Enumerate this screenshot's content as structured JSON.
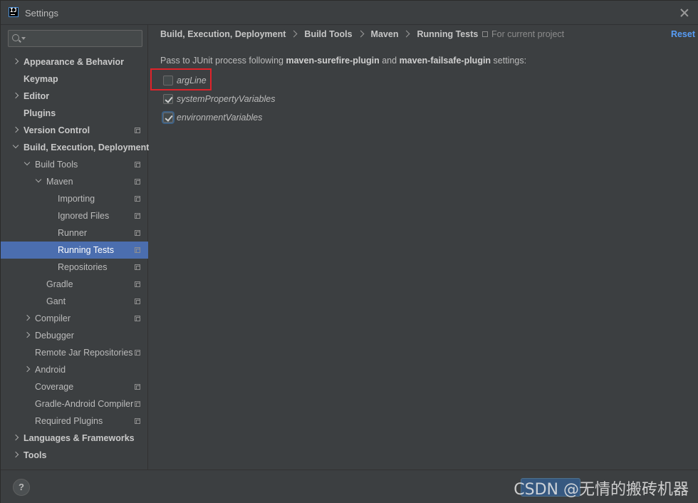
{
  "window": {
    "title": "Settings"
  },
  "sidebar": {
    "search": {
      "value": "",
      "placeholder": ""
    },
    "items": [
      {
        "label": "Appearance & Behavior",
        "level": 0,
        "arrow": "right",
        "bold": true,
        "project": false,
        "selected": false
      },
      {
        "label": "Keymap",
        "level": 0,
        "arrow": "none",
        "bold": true,
        "project": false,
        "selected": false
      },
      {
        "label": "Editor",
        "level": 0,
        "arrow": "right",
        "bold": true,
        "project": false,
        "selected": false
      },
      {
        "label": "Plugins",
        "level": 0,
        "arrow": "none",
        "bold": true,
        "project": false,
        "selected": false
      },
      {
        "label": "Version Control",
        "level": 0,
        "arrow": "right",
        "bold": true,
        "project": true,
        "selected": false
      },
      {
        "label": "Build, Execution, Deployment",
        "level": 0,
        "arrow": "down",
        "bold": true,
        "project": false,
        "selected": false
      },
      {
        "label": "Build Tools",
        "level": 1,
        "arrow": "down",
        "bold": false,
        "project": true,
        "selected": false
      },
      {
        "label": "Maven",
        "level": 2,
        "arrow": "down",
        "bold": false,
        "project": true,
        "selected": false
      },
      {
        "label": "Importing",
        "level": 3,
        "arrow": "none",
        "bold": false,
        "project": true,
        "selected": false
      },
      {
        "label": "Ignored Files",
        "level": 3,
        "arrow": "none",
        "bold": false,
        "project": true,
        "selected": false
      },
      {
        "label": "Runner",
        "level": 3,
        "arrow": "none",
        "bold": false,
        "project": true,
        "selected": false
      },
      {
        "label": "Running Tests",
        "level": 3,
        "arrow": "none",
        "bold": false,
        "project": true,
        "selected": true
      },
      {
        "label": "Repositories",
        "level": 3,
        "arrow": "none",
        "bold": false,
        "project": true,
        "selected": false
      },
      {
        "label": "Gradle",
        "level": 2,
        "arrow": "none",
        "bold": false,
        "project": true,
        "selected": false
      },
      {
        "label": "Gant",
        "level": 2,
        "arrow": "none",
        "bold": false,
        "project": true,
        "selected": false
      },
      {
        "label": "Compiler",
        "level": 1,
        "arrow": "right",
        "bold": false,
        "project": true,
        "selected": false
      },
      {
        "label": "Debugger",
        "level": 1,
        "arrow": "right",
        "bold": false,
        "project": false,
        "selected": false
      },
      {
        "label": "Remote Jar Repositories",
        "level": 1,
        "arrow": "none",
        "bold": false,
        "project": true,
        "selected": false
      },
      {
        "label": "Android",
        "level": 1,
        "arrow": "right",
        "bold": false,
        "project": false,
        "selected": false
      },
      {
        "label": "Coverage",
        "level": 1,
        "arrow": "none",
        "bold": false,
        "project": true,
        "selected": false
      },
      {
        "label": "Gradle-Android Compiler",
        "level": 1,
        "arrow": "none",
        "bold": false,
        "project": true,
        "selected": false
      },
      {
        "label": "Required Plugins",
        "level": 1,
        "arrow": "none",
        "bold": false,
        "project": true,
        "selected": false
      },
      {
        "label": "Languages & Frameworks",
        "level": 0,
        "arrow": "right",
        "bold": true,
        "project": false,
        "selected": false
      },
      {
        "label": "Tools",
        "level": 0,
        "arrow": "right",
        "bold": true,
        "project": false,
        "selected": false
      }
    ]
  },
  "main": {
    "breadcrumb": [
      "Build, Execution, Deployment",
      "Build Tools",
      "Maven",
      "Running Tests"
    ],
    "for_project": "For current project",
    "reset_label": "Reset",
    "description": {
      "prefix": "Pass to JUnit process following ",
      "plugin1": "maven-surefire-plugin",
      "middle": " and ",
      "plugin2": "maven-failsafe-plugin",
      "suffix": " settings:"
    },
    "checkboxes": [
      {
        "label": "argLine",
        "checked": false
      },
      {
        "label": "systemPropertyVariables",
        "checked": true
      },
      {
        "label": "environmentVariables",
        "checked": true
      }
    ]
  },
  "footer": {
    "help_label": "?",
    "watermark": "CSDN @无情的搬砖机器"
  },
  "colors": {
    "background": "#3c3f41",
    "selection": "#4b6eaf",
    "link": "#589df6",
    "highlight": "#e0232a"
  }
}
